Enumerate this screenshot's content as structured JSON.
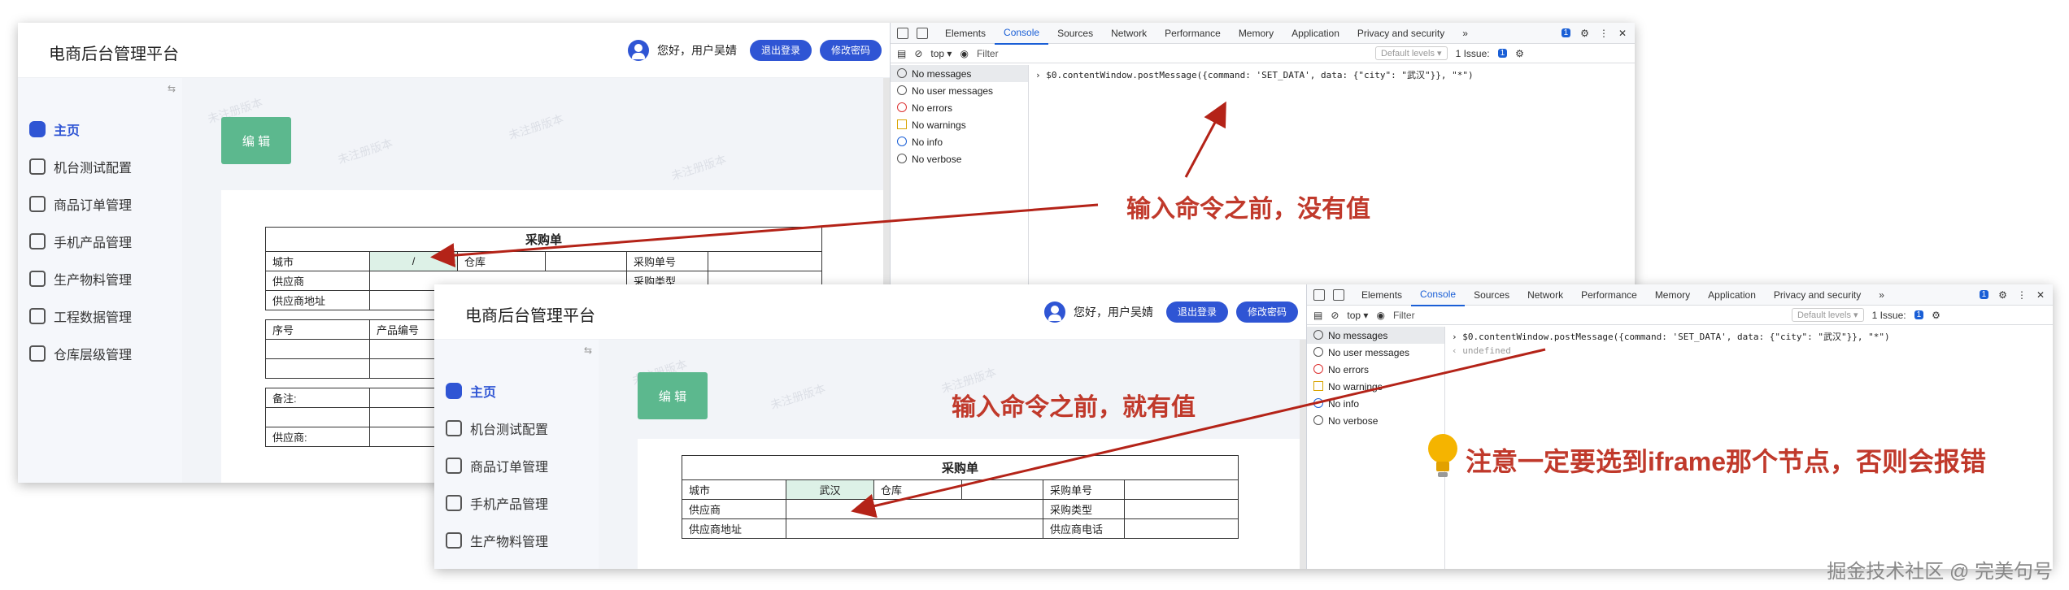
{
  "app": {
    "title": "电商后台管理平台",
    "greeting": "您好，用户吴婧",
    "logout_label": "退出登录",
    "change_password_label": "修改密码",
    "collapse_icon": "⇆",
    "watermark": "未注册版本",
    "menu": [
      {
        "label": "主页",
        "icon": "home-icon",
        "active": true
      },
      {
        "label": "机台测试配置",
        "icon": "device-icon",
        "active": false
      },
      {
        "label": "商品订单管理",
        "icon": "order-icon",
        "active": false
      },
      {
        "label": "手机产品管理",
        "icon": "grid-icon",
        "active": false
      },
      {
        "label": "生产物料管理",
        "icon": "user-icon",
        "active": false
      },
      {
        "label": "工程数据管理",
        "icon": "table-icon",
        "active": false
      },
      {
        "label": "仓库层级管理",
        "icon": "user-icon",
        "active": false
      }
    ],
    "edit_label": "编 辑",
    "form": {
      "title": "采购单",
      "city_label": "城市",
      "warehouse_label": "仓库",
      "po_number_label": "采购单号",
      "supplier_label": "供应商",
      "po_type_label": "采购类型",
      "supplier_address_label": "供应商地址",
      "supplier_phone_label": "供应商电话",
      "seq_label": "序号",
      "product_code_label": "产品编号",
      "remark_label": "备注:",
      "supplier_sign_label": "供应商:"
    }
  },
  "shot1": {
    "city_value": "/"
  },
  "shot2": {
    "city_value": "武汉"
  },
  "devtools": {
    "tabs": [
      "Elements",
      "Console",
      "Sources",
      "Network",
      "Performance",
      "Memory",
      "Application",
      "Privacy and security",
      "»"
    ],
    "selected_tab": "Console",
    "issue_badge": "1",
    "context": "top ▾",
    "filter_placeholder": "Filter",
    "levels": "Default levels ▾",
    "issues": "1 Issue:",
    "issues_count": "1",
    "sidebar": [
      "No messages",
      "No user messages",
      "No errors",
      "No warnings",
      "No info",
      "No verbose"
    ],
    "command": "$0.contentWindow.postMessage({command: 'SET_DATA', data: {\"city\": \"武汉\"}}, \"*\")",
    "return_value": "undefined"
  },
  "annotations": {
    "before_no_value": "输入命令之前，没有值",
    "before_has_value": "输入命令之前，就有值",
    "note": "注意一定要选到iframe那个节点，否则会报错",
    "accent": "#b42318"
  },
  "footer": "掘金技术社区 @ 完美句号"
}
